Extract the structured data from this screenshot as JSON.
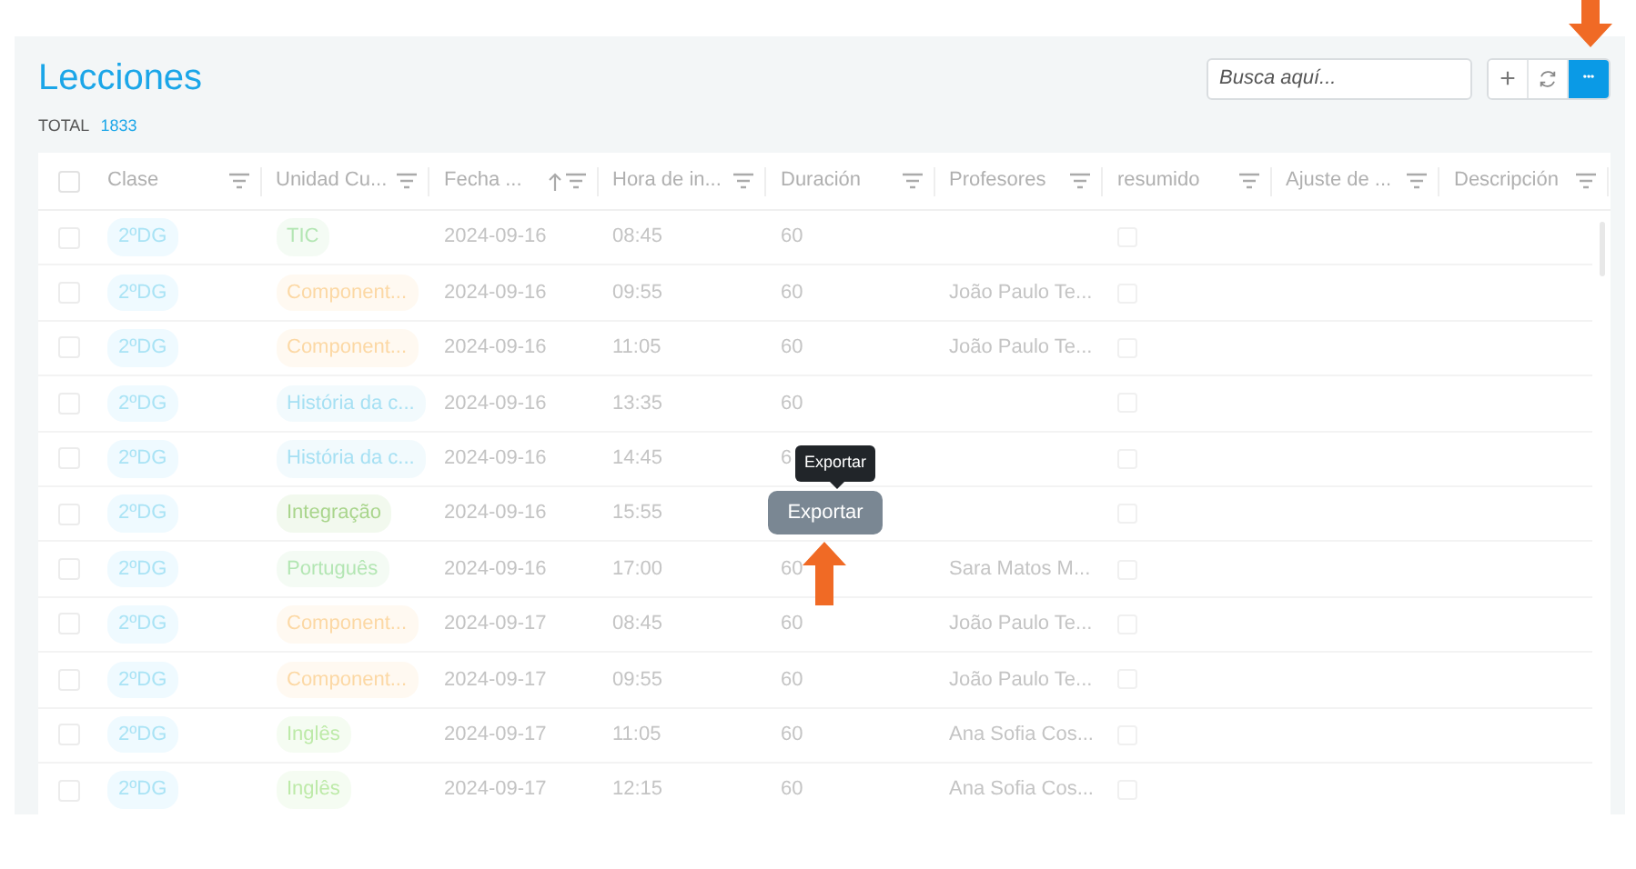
{
  "title": "Lecciones",
  "total": {
    "label": "TOTAL",
    "value": "1833"
  },
  "search": {
    "placeholder": "Busca aquí..."
  },
  "toolbar": {
    "add": "+",
    "more": "•••"
  },
  "table": {
    "all_checked": false,
    "columns": [
      {
        "label": "Clase",
        "sorted": false
      },
      {
        "label": "Unidad Cu...",
        "sorted": false
      },
      {
        "label": "Fecha ...",
        "sorted": true
      },
      {
        "label": "Hora de in...",
        "sorted": false
      },
      {
        "label": "Duración",
        "sorted": false
      },
      {
        "label": "Profesores",
        "sorted": false
      },
      {
        "label": "resumido",
        "sorted": false
      },
      {
        "label": "Ajuste de ...",
        "sorted": false
      },
      {
        "label": "Descripción",
        "sorted": false
      }
    ],
    "rows": [
      {
        "clase": "2ºDG",
        "unidad": "TIC",
        "color": "#b3e6b3",
        "fecha": "2024-09-16",
        "hora": "08:45",
        "duracion": "60",
        "profesor": "",
        "checked": false,
        "resumido": false
      },
      {
        "clase": "2ºDG",
        "unidad": "Component...",
        "color": "#fcd8a4",
        "fecha": "2024-09-16",
        "hora": "09:55",
        "duracion": "60",
        "profesor": "João Paulo Te...",
        "checked": false,
        "resumido": false
      },
      {
        "clase": "2ºDG",
        "unidad": "Component...",
        "color": "#fcd8a4",
        "fecha": "2024-09-16",
        "hora": "11:05",
        "duracion": "60",
        "profesor": "João Paulo Te...",
        "checked": false,
        "resumido": false
      },
      {
        "clase": "2ºDG",
        "unidad": "História da c...",
        "color": "#a6e0f3",
        "fecha": "2024-09-16",
        "hora": "13:35",
        "duracion": "60",
        "profesor": "",
        "checked": false,
        "resumido": false
      },
      {
        "clase": "2ºDG",
        "unidad": "História da c...",
        "color": "#a6e0f3",
        "fecha": "2024-09-16",
        "hora": "14:45",
        "duracion": "6",
        "profesor": "",
        "checked": false,
        "resumido": false
      },
      {
        "clase": "2ºDG",
        "unidad": "Integração",
        "color": "#a9d58c",
        "fecha": "2024-09-16",
        "hora": "15:55",
        "duracion": "",
        "profesor": "",
        "checked": false,
        "resumido": false
      },
      {
        "clase": "2ºDG",
        "unidad": "Português",
        "color": "#b3e6b3",
        "fecha": "2024-09-16",
        "hora": "17:00",
        "duracion": "60",
        "profesor": "Sara Matos M...",
        "checked": false,
        "resumido": false
      },
      {
        "clase": "2ºDG",
        "unidad": "Component...",
        "color": "#fcd8a4",
        "fecha": "2024-09-17",
        "hora": "08:45",
        "duracion": "60",
        "profesor": "João Paulo Te...",
        "checked": false,
        "resumido": false
      },
      {
        "clase": "2ºDG",
        "unidad": "Component...",
        "color": "#fcd8a4",
        "fecha": "2024-09-17",
        "hora": "09:55",
        "duracion": "60",
        "profesor": "João Paulo Te...",
        "checked": false,
        "resumido": false
      },
      {
        "clase": "2ºDG",
        "unidad": "Inglês",
        "color": "#bdeaa8",
        "fecha": "2024-09-17",
        "hora": "11:05",
        "duracion": "60",
        "profesor": "Ana Sofia Cos...",
        "checked": false,
        "resumido": false
      },
      {
        "clase": "2ºDG",
        "unidad": "Inglês",
        "color": "#bdeaa8",
        "fecha": "2024-09-17",
        "hora": "12:15",
        "duracion": "60",
        "profesor": "Ana Sofia Cos...",
        "checked": false,
        "resumido": false
      }
    ]
  },
  "tooltip": "Exportar",
  "export_button": "Exportar"
}
